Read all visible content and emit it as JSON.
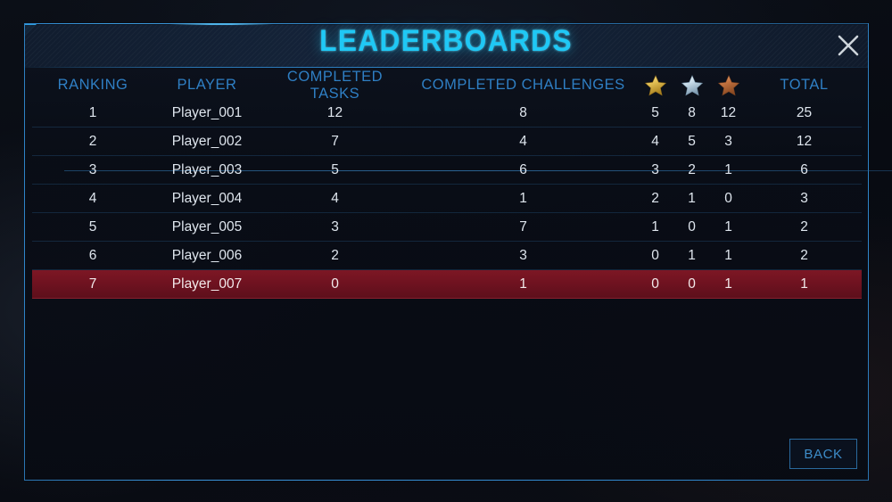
{
  "window": {
    "title": "LEADERBOARDS",
    "close_icon": "close-x-icon"
  },
  "theme": {
    "accent_cyan": "#1fc8f5",
    "header_blue": "#2f7fc4",
    "frame_blue": "#2f86cb",
    "highlight_red": "#7d1724",
    "panel_bg": "#0b111c",
    "star_gold": "#e8c659",
    "star_silver": "#cfe3ef",
    "star_bronze": "#c1713f",
    "row_text": "#dfe6ee"
  },
  "table": {
    "columns": [
      {
        "key": "ranking",
        "label": "RANKING"
      },
      {
        "key": "player",
        "label": "PLAYER"
      },
      {
        "key": "completed_tasks",
        "label": "COMPLETED TASKS"
      },
      {
        "key": "completed_challenges",
        "label": "COMPLETED CHALLENGES"
      },
      {
        "key": "gold",
        "label": "",
        "icon": "star-gold-icon"
      },
      {
        "key": "silver",
        "label": "",
        "icon": "star-silver-icon"
      },
      {
        "key": "bronze",
        "label": "",
        "icon": "star-bronze-icon"
      },
      {
        "key": "total",
        "label": "TOTAL"
      }
    ],
    "rows": [
      {
        "ranking": "1",
        "player": "Player_001",
        "completed_tasks": "12",
        "completed_challenges": "8",
        "gold": "5",
        "silver": "8",
        "bronze": "12",
        "total": "25",
        "highlighted": false
      },
      {
        "ranking": "2",
        "player": "Player_002",
        "completed_tasks": "7",
        "completed_challenges": "4",
        "gold": "4",
        "silver": "5",
        "bronze": "3",
        "total": "12",
        "highlighted": false
      },
      {
        "ranking": "3",
        "player": "Player_003",
        "completed_tasks": "5",
        "completed_challenges": "6",
        "gold": "3",
        "silver": "2",
        "bronze": "1",
        "total": "6",
        "highlighted": false
      },
      {
        "ranking": "4",
        "player": "Player_004",
        "completed_tasks": "4",
        "completed_challenges": "1",
        "gold": "2",
        "silver": "1",
        "bronze": "0",
        "total": "3",
        "highlighted": false
      },
      {
        "ranking": "5",
        "player": "Player_005",
        "completed_tasks": "3",
        "completed_challenges": "7",
        "gold": "1",
        "silver": "0",
        "bronze": "1",
        "total": "2",
        "highlighted": false
      },
      {
        "ranking": "6",
        "player": "Player_006",
        "completed_tasks": "2",
        "completed_challenges": "3",
        "gold": "0",
        "silver": "1",
        "bronze": "1",
        "total": "2",
        "highlighted": false
      },
      {
        "ranking": "7",
        "player": "Player_007",
        "completed_tasks": "0",
        "completed_challenges": "1",
        "gold": "0",
        "silver": "0",
        "bronze": "1",
        "total": "1",
        "highlighted": true
      }
    ]
  },
  "footer": {
    "back_label": "BACK"
  }
}
